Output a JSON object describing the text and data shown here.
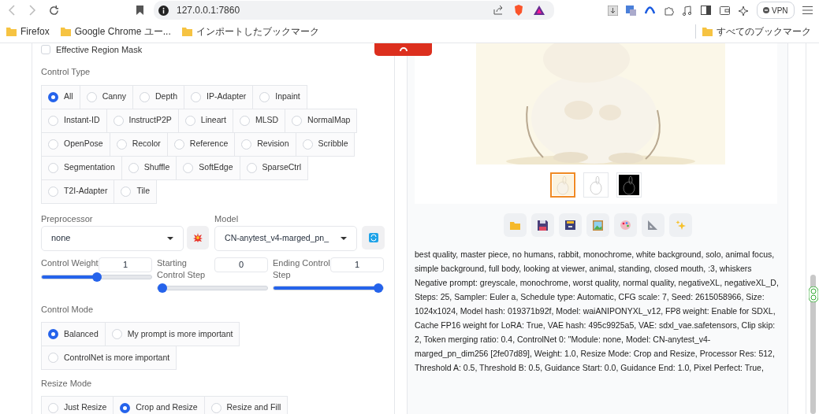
{
  "browser": {
    "url": "127.0.0.1:7860",
    "vpn_label": "VPN",
    "bookmarks": [
      "Firefox",
      "Google Chrome ユー...",
      "インポートしたブックマーク"
    ],
    "all_bookmarks": "すべてのブックマーク"
  },
  "controlnet": {
    "effective_region_mask": {
      "label": "Effective Region Mask",
      "checked": false
    },
    "control_type": {
      "label": "Control Type",
      "options": [
        {
          "label": "All",
          "selected": true
        },
        {
          "label": "Canny",
          "selected": false
        },
        {
          "label": "Depth",
          "selected": false
        },
        {
          "label": "IP-Adapter",
          "selected": false
        },
        {
          "label": "Inpaint",
          "selected": false
        },
        {
          "label": "Instant-ID",
          "selected": false
        },
        {
          "label": "InstructP2P",
          "selected": false
        },
        {
          "label": "Lineart",
          "selected": false
        },
        {
          "label": "MLSD",
          "selected": false
        },
        {
          "label": "NormalMap",
          "selected": false
        },
        {
          "label": "OpenPose",
          "selected": false
        },
        {
          "label": "Recolor",
          "selected": false
        },
        {
          "label": "Reference",
          "selected": false
        },
        {
          "label": "Revision",
          "selected": false
        },
        {
          "label": "Scribble",
          "selected": false
        },
        {
          "label": "Segmentation",
          "selected": false
        },
        {
          "label": "Shuffle",
          "selected": false
        },
        {
          "label": "SoftEdge",
          "selected": false
        },
        {
          "label": "SparseCtrl",
          "selected": false
        },
        {
          "label": "T2I-Adapter",
          "selected": false
        },
        {
          "label": "Tile",
          "selected": false
        }
      ]
    },
    "preprocessor": {
      "label": "Preprocessor",
      "value": "none"
    },
    "model": {
      "label": "Model",
      "value": "CN-anytest_v4-marged_pn_"
    },
    "sliders": [
      {
        "label": "Control Weight",
        "value": "1",
        "level": 0.5
      },
      {
        "label": "Starting Control Step",
        "value": "0",
        "level": 0
      },
      {
        "label": "Ending Control Step",
        "value": "1",
        "level": 1
      }
    ],
    "control_mode": {
      "label": "Control Mode",
      "options": [
        {
          "label": "Balanced",
          "selected": true
        },
        {
          "label": "My prompt is more important",
          "selected": false
        },
        {
          "label": "ControlNet is more important",
          "selected": false
        }
      ]
    },
    "resize_mode": {
      "label": "Resize Mode",
      "options": [
        {
          "label": "Just Resize",
          "selected": false
        },
        {
          "label": "Crop and Resize",
          "selected": true
        },
        {
          "label": "Resize and Fill",
          "selected": false
        }
      ]
    }
  },
  "output": {
    "thumbnails": [
      {
        "kind": "color",
        "selected": true
      },
      {
        "kind": "lineart",
        "selected": false
      },
      {
        "kind": "dark",
        "selected": false
      }
    ],
    "info": [
      "best quality, master piece, no humans, rabbit, monochrome, white background, solo, animal focus, simple background, full body, looking at viewer, animal, standing, closed mouth, :3, whiskers",
      "Negative prompt: greyscale, monochrome, worst quality, normal quality, negativeXL, negativeXL_D,",
      "Steps: 25, Sampler: Euler a, Schedule type: Automatic, CFG scale: 7, Seed: 2615058966, Size: 1024x1024, Model hash: 019371b92f, Model: waiANIPONYXL_v12, FP8 weight: Enable for SDXL, Cache FP16 weight for LoRA: True, VAE hash: 495c9925a5, VAE: sdxl_vae.safetensors, Clip skip: 2, Token merging ratio: 0.4, ControlNet 0: \"Module: none, Model: CN-anytest_v4-marged_pn_dim256 [2fe07d89], Weight: 1.0, Resize Mode: Crop and Resize, Processor Res: 512, Threshold A: 0.5, Threshold B: 0.5, Guidance Start: 0.0, Guidance End: 1.0, Pixel Perfect: True,"
    ]
  }
}
